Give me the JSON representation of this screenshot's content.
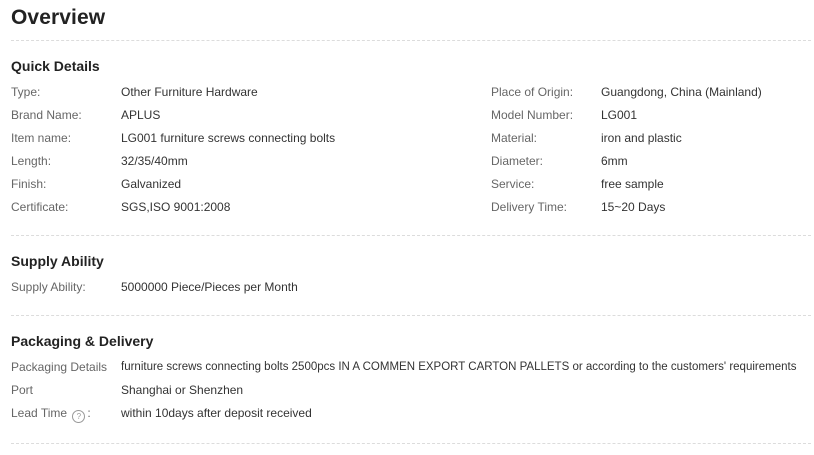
{
  "title": "Overview",
  "quick_details": {
    "heading": "Quick Details",
    "left": [
      {
        "label": "Type:",
        "value": "Other Furniture Hardware"
      },
      {
        "label": "Brand Name:",
        "value": "APLUS"
      },
      {
        "label": "Item name:",
        "value": "LG001 furniture screws connecting bolts"
      },
      {
        "label": "Length:",
        "value": "32/35/40mm"
      },
      {
        "label": "Finish:",
        "value": "Galvanized"
      },
      {
        "label": "Certificate:",
        "value": "SGS,ISO 9001:2008"
      }
    ],
    "right": [
      {
        "label": "Place of Origin:",
        "value": "Guangdong, China (Mainland)"
      },
      {
        "label": "Model Number:",
        "value": "LG001"
      },
      {
        "label": "Material:",
        "value": "iron and plastic"
      },
      {
        "label": "Diameter:",
        "value": "6mm"
      },
      {
        "label": "Service:",
        "value": "free sample"
      },
      {
        "label": "Delivery Time:",
        "value": "15~20 Days"
      }
    ]
  },
  "supply_ability": {
    "heading": "Supply Ability",
    "label": "Supply Ability:",
    "value": "5000000 Piece/Pieces per Month"
  },
  "packaging": {
    "heading": "Packaging & Delivery",
    "details_label": "Packaging Details",
    "details_value": "furniture screws connecting bolts 2500pcs IN A COMMEN EXPORT CARTON PALLETS or according to the customers' requirements",
    "port_label": "Port",
    "port_value": "Shanghai or Shenzhen",
    "lead_label": "Lead Time",
    "lead_icon": "?",
    "lead_colon": ":",
    "lead_value": "within 10days after deposit received"
  }
}
